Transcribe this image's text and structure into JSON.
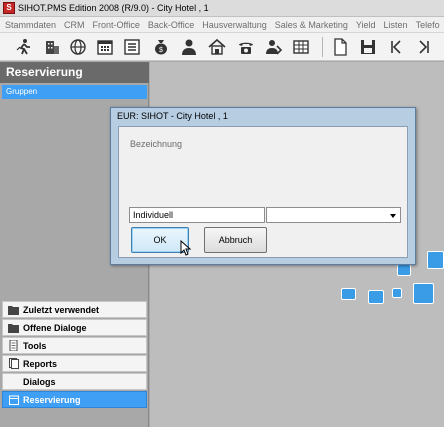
{
  "window": {
    "title": "SIHOT.PMS Edition 2008 (R/9.0) - City Hotel , 1",
    "app_icon": "S"
  },
  "menu": [
    "Stammdaten",
    "CRM",
    "Front-Office",
    "Back-Office",
    "Hausverwaltung",
    "Sales & Marketing",
    "Yield",
    "Listen",
    "Telefo"
  ],
  "toolbar": {
    "icons": [
      "walk-in-icon",
      "building-icon",
      "globe-icon",
      "calendar-grid-icon",
      "list-icon",
      "money-bag-icon",
      "person-icon",
      "house-icon",
      "telephone-icon",
      "group-icon",
      "table-icon",
      "new-document-icon",
      "save-icon",
      "first-record-icon",
      "next-record-icon"
    ]
  },
  "sidebar": {
    "title": "Reservierung",
    "selected_item": "Gruppen",
    "nav": [
      {
        "label": "Zuletzt verwendet",
        "icon": "folder-icon",
        "active": false
      },
      {
        "label": "Offene Dialoge",
        "icon": "folder-icon",
        "active": false
      },
      {
        "label": "Tools",
        "icon": "tools-icon",
        "active": false
      },
      {
        "label": "Reports",
        "icon": "reports-icon",
        "active": false
      },
      {
        "label": "Dialogs",
        "icon": "",
        "active": false
      },
      {
        "label": "Reservierung",
        "icon": "reservation-icon",
        "active": true
      }
    ]
  },
  "dialog": {
    "title": "EUR: SIHOT - City Hotel , 1",
    "label": "Bezeichnung",
    "input_value": "Individuell",
    "select_value": "",
    "ok_label": "OK",
    "cancel_label": "Abbruch"
  },
  "colors": {
    "accent": "#3f9ff4",
    "header": "#6a6a6a",
    "workspace": "#bdbdbd",
    "dialog_frame": "#b7cde2"
  }
}
